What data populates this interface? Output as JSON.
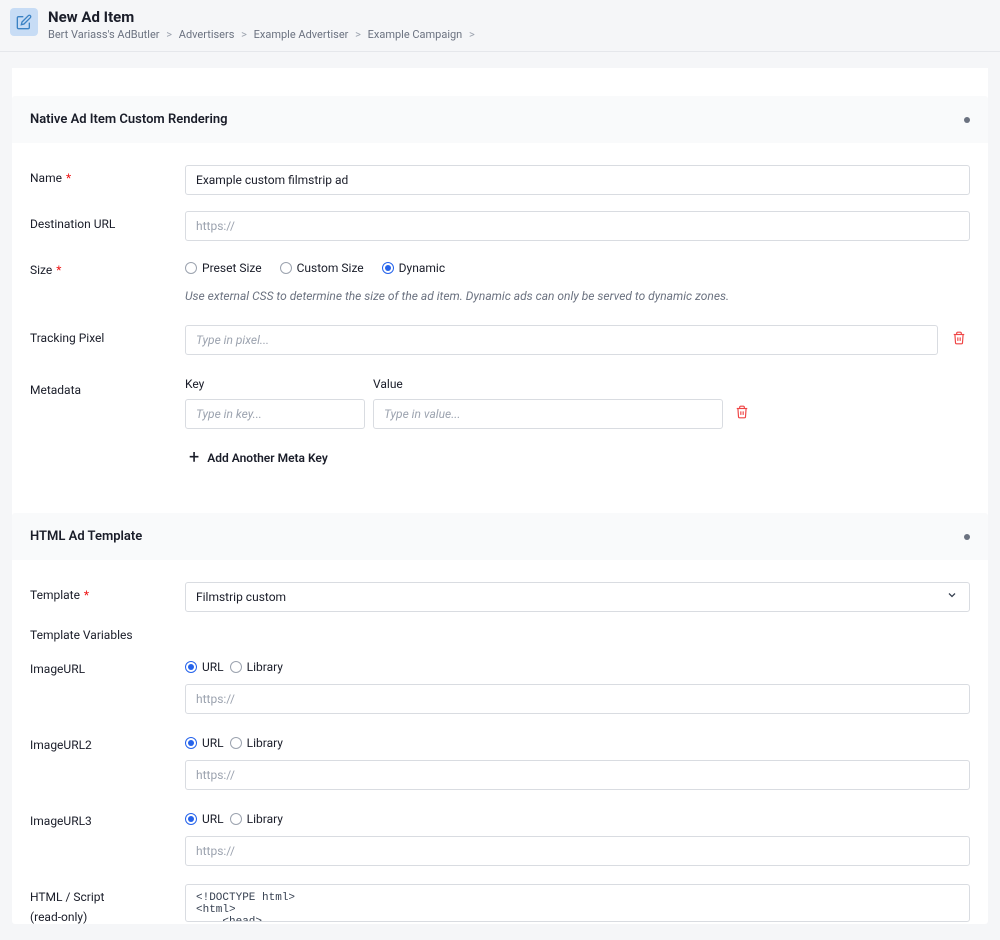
{
  "header": {
    "title": "New Ad Item",
    "breadcrumb": [
      "Bert Variass's AdButler",
      "Advertisers",
      "Example Advertiser",
      "Example Campaign"
    ]
  },
  "section1": {
    "title": "Native Ad Item Custom Rendering",
    "name_label": "Name",
    "name_value": "Example custom filmstrip ad",
    "dest_label": "Destination URL",
    "dest_placeholder": "https://",
    "size_label": "Size",
    "size_options": {
      "preset": "Preset Size",
      "custom": "Custom Size",
      "dynamic": "Dynamic"
    },
    "size_hint": "Use external CSS to determine the size of the ad item. Dynamic ads can only be served to dynamic zones.",
    "pixel_label": "Tracking Pixel",
    "pixel_placeholder": "Type in pixel...",
    "meta_label": "Metadata",
    "meta_key_header": "Key",
    "meta_val_header": "Value",
    "meta_key_placeholder": "Type in key...",
    "meta_val_placeholder": "Type in value...",
    "add_meta_label": "Add Another Meta Key"
  },
  "section2": {
    "title": "HTML Ad Template",
    "template_label": "Template",
    "template_value": "Filmstrip custom",
    "variables_label": "Template Variables",
    "imgurl_label": "ImageURL",
    "imgurl2_label": "ImageURL2",
    "imgurl3_label": "ImageURL3",
    "source_url": "URL",
    "source_lib": "Library",
    "url_placeholder": "https://",
    "html_label": "HTML / Script",
    "html_readonly": "(read-only)",
    "html_content": "<!DOCTYPE html>\n<html>\n    <head>"
  }
}
